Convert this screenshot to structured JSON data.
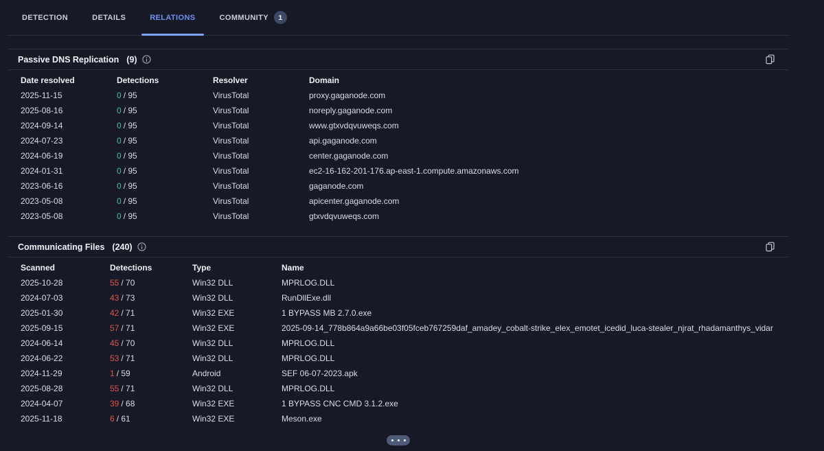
{
  "tabs": {
    "items": [
      {
        "label": "DETECTION",
        "active": false
      },
      {
        "label": "DETAILS",
        "active": false
      },
      {
        "label": "RELATIONS",
        "active": true
      },
      {
        "label": "COMMUNITY",
        "active": false,
        "badge": "1"
      }
    ]
  },
  "sections": [
    {
      "title": "Passive DNS Replication",
      "count": "(9)",
      "columns": [
        "Date resolved",
        "Detections",
        "Resolver",
        "Domain"
      ],
      "rows": [
        {
          "date": "2025-11-15",
          "num": "0",
          "den": "/ 95",
          "resolver": "VirusTotal",
          "domain": "proxy.gaganode.com"
        },
        {
          "date": "2025-08-16",
          "num": "0",
          "den": "/ 95",
          "resolver": "VirusTotal",
          "domain": "noreply.gaganode.com"
        },
        {
          "date": "2024-09-14",
          "num": "0",
          "den": "/ 95",
          "resolver": "VirusTotal",
          "domain": "www.gtxvdqvuweqs.com"
        },
        {
          "date": "2024-07-23",
          "num": "0",
          "den": "/ 95",
          "resolver": "VirusTotal",
          "domain": "api.gaganode.com"
        },
        {
          "date": "2024-06-19",
          "num": "0",
          "den": "/ 95",
          "resolver": "VirusTotal",
          "domain": "center.gaganode.com"
        },
        {
          "date": "2024-01-31",
          "num": "0",
          "den": "/ 95",
          "resolver": "VirusTotal",
          "domain": "ec2-16-162-201-176.ap-east-1.compute.amazonaws.com"
        },
        {
          "date": "2023-06-16",
          "num": "0",
          "den": "/ 95",
          "resolver": "VirusTotal",
          "domain": "gaganode.com"
        },
        {
          "date": "2023-05-08",
          "num": "0",
          "den": "/ 95",
          "resolver": "VirusTotal",
          "domain": "apicenter.gaganode.com"
        },
        {
          "date": "2023-05-08",
          "num": "0",
          "den": "/ 95",
          "resolver": "VirusTotal",
          "domain": "gtxvdqvuweqs.com"
        }
      ]
    },
    {
      "title": "Communicating Files",
      "count": "(240)",
      "columns": [
        "Scanned",
        "Detections",
        "Type",
        "Name"
      ],
      "rows": [
        {
          "date": "2025-10-28",
          "num": "55",
          "den": "/ 70",
          "type": "Win32 DLL",
          "name": "MPRLOG.DLL"
        },
        {
          "date": "2024-07-03",
          "num": "43",
          "den": "/ 73",
          "type": "Win32 DLL",
          "name": "RunDllExe.dll"
        },
        {
          "date": "2025-01-30",
          "num": "42",
          "den": "/ 71",
          "type": "Win32 EXE",
          "name": "1 BYPASS MB 2.7.0.exe"
        },
        {
          "date": "2025-09-15",
          "num": "57",
          "den": "/ 71",
          "type": "Win32 EXE",
          "name": "2025-09-14_778b864a9a66be03f05fceb767259daf_amadey_cobalt-strike_elex_emotet_icedid_luca-stealer_njrat_rhadamanthys_vidar"
        },
        {
          "date": "2024-06-14",
          "num": "45",
          "den": "/ 70",
          "type": "Win32 DLL",
          "name": "MPRLOG.DLL"
        },
        {
          "date": "2024-06-22",
          "num": "53",
          "den": "/ 71",
          "type": "Win32 DLL",
          "name": "MPRLOG.DLL"
        },
        {
          "date": "2024-11-29",
          "num": "1",
          "den": "/ 59",
          "type": "Android",
          "name": "SEF 06-07-2023.apk"
        },
        {
          "date": "2025-08-28",
          "num": "55",
          "den": "/ 71",
          "type": "Win32 DLL",
          "name": "MPRLOG.DLL"
        },
        {
          "date": "2024-04-07",
          "num": "39",
          "den": "/ 68",
          "type": "Win32 EXE",
          "name": "1 BYPASS CNC CMD 3.1.2.exe"
        },
        {
          "date": "2025-11-18",
          "num": "6",
          "den": "/ 61",
          "type": "Win32 EXE",
          "name": "Meson.exe"
        }
      ]
    }
  ],
  "icons": {
    "info": "info-circle-icon",
    "copy": "copy-icon",
    "more": "ellipsis-dots-icon"
  },
  "colors": {
    "background": "#171a26",
    "border": "#2b3248",
    "tab_active": "#7191f0",
    "tab_underline": "#7ea1f4",
    "detections_clean_green": "#3fc1a0",
    "detections_malicious_red": "#e0524a",
    "badge_background": "#3c4866"
  }
}
